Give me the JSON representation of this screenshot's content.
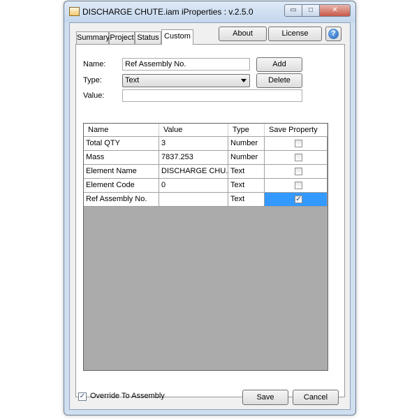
{
  "window": {
    "title": "DISCHARGE CHUTE.iam iProperties : v.2.5.0",
    "minimize_glyph": "▭",
    "maximize_glyph": "□",
    "close_glyph": "✕"
  },
  "tabs": [
    {
      "label": "Summary"
    },
    {
      "label": "Project"
    },
    {
      "label": "Status"
    },
    {
      "label": "Custom"
    }
  ],
  "toolbar": {
    "about_label": "About",
    "license_label": "License",
    "help_glyph": "?"
  },
  "form": {
    "name_label": "Name:",
    "name_value": "Ref Assembly No.",
    "type_label": "Type:",
    "type_value": "Text",
    "value_label": "Value:",
    "value_value": "",
    "add_label": "Add",
    "delete_label": "Delete"
  },
  "grid": {
    "columns": [
      "Name",
      "Value",
      "Type",
      "Save Property"
    ],
    "rows": [
      {
        "name": "Total QTY",
        "value": "3",
        "type": "Number",
        "save": false
      },
      {
        "name": "Mass",
        "value": "7837.253",
        "type": "Number",
        "save": false
      },
      {
        "name": "Element Name",
        "value": "DISCHARGE CHU...",
        "type": "Text",
        "save": false
      },
      {
        "name": "Element Code",
        "value": "0",
        "type": "Text",
        "save": false
      },
      {
        "name": "Ref Assembly No.",
        "value": "",
        "type": "Text",
        "save": true
      }
    ]
  },
  "footer": {
    "override_label": "Override To Assembly",
    "override_checked": true,
    "save_label": "Save",
    "cancel_label": "Cancel"
  },
  "colors": {
    "selection": "#3399ff",
    "grid_empty": "#ababab"
  }
}
